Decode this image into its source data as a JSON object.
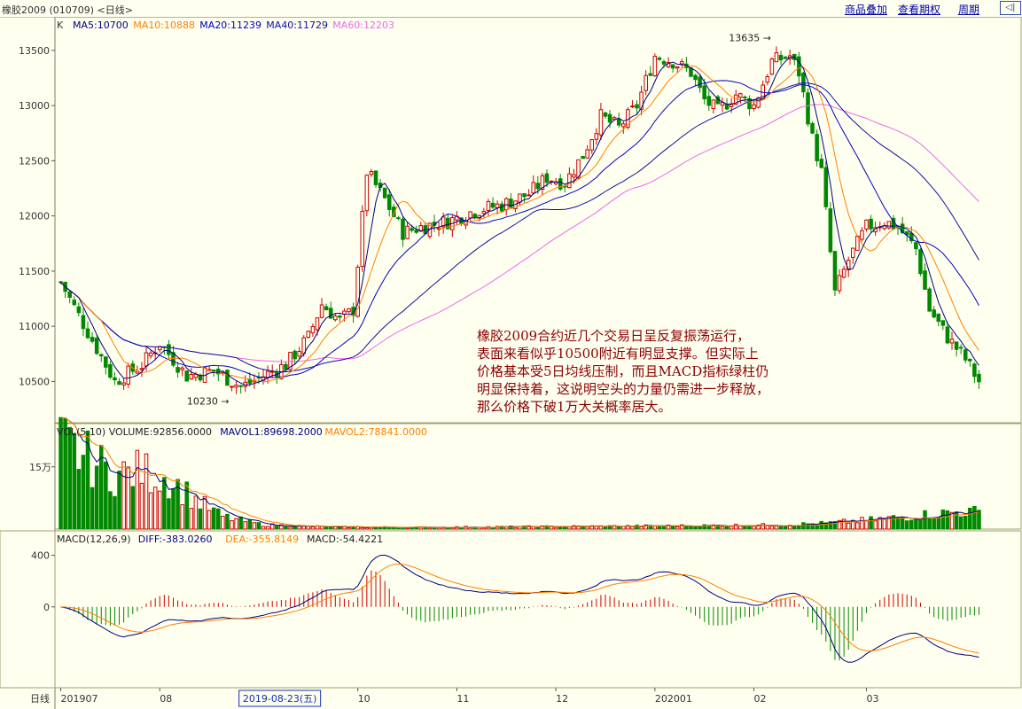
{
  "header": {
    "title": "橡胶2009 (010709) <日线>",
    "links": [
      "商品叠加",
      "查看期权",
      "周期"
    ],
    "nav_icon": "arrow-left-box-icon"
  },
  "colors": {
    "background": "#fffff0",
    "up": "#cc0000",
    "down": "#008800",
    "ma5": "#000080",
    "ma10": "#ff8000",
    "ma20": "#0000c0",
    "ma40": "#1010a0",
    "ma60": "#ee66ee",
    "grid": "#c8c8a0"
  },
  "chart_data": [
    {
      "type": "candlestick",
      "title": "",
      "legend": {
        "prefix": "K",
        "items": [
          {
            "text": "MA5:10700",
            "color": "#000080"
          },
          {
            "text": "MA10:10888",
            "color": "#ff8000"
          },
          {
            "text": "MA20:11239",
            "color": "#0000c0"
          },
          {
            "text": "MA40:11729",
            "color": "#1010a0"
          },
          {
            "text": "MA60:12203",
            "color": "#ee66ee"
          }
        ]
      },
      "yticks": [
        13500,
        13000,
        12500,
        12000,
        11500,
        11000,
        10500
      ],
      "ylim": [
        10150,
        13780
      ],
      "anchors_close": [
        [
          0,
          11400
        ],
        [
          6,
          10950
        ],
        [
          12,
          10500
        ],
        [
          18,
          10650
        ],
        [
          22,
          10850
        ],
        [
          28,
          10550
        ],
        [
          34,
          10600
        ],
        [
          40,
          10450
        ],
        [
          45,
          10550
        ],
        [
          50,
          10650
        ],
        [
          55,
          10900
        ],
        [
          58,
          11200
        ],
        [
          62,
          11050
        ],
        [
          65,
          11150
        ],
        [
          68,
          12400
        ],
        [
          72,
          12150
        ],
        [
          76,
          11850
        ],
        [
          80,
          11900
        ],
        [
          86,
          11950
        ],
        [
          92,
          12050
        ],
        [
          98,
          12100
        ],
        [
          104,
          12200
        ],
        [
          108,
          12350
        ],
        [
          112,
          12300
        ],
        [
          116,
          12550
        ],
        [
          120,
          12900
        ],
        [
          124,
          12800
        ],
        [
          128,
          13000
        ],
        [
          132,
          13450
        ],
        [
          136,
          13400
        ],
        [
          140,
          13300
        ],
        [
          143,
          13050
        ],
        [
          146,
          12950
        ],
        [
          150,
          13100
        ],
        [
          154,
          13000
        ],
        [
          158,
          13400
        ],
        [
          162,
          13450
        ],
        [
          164,
          13300
        ],
        [
          167,
          12700
        ],
        [
          169,
          12400
        ],
        [
          172,
          11300
        ],
        [
          175,
          11600
        ],
        [
          179,
          11900
        ],
        [
          183,
          11950
        ],
        [
          186,
          11900
        ],
        [
          190,
          11700
        ],
        [
          193,
          11150
        ],
        [
          197,
          10900
        ],
        [
          201,
          10700
        ],
        [
          204,
          10500
        ]
      ],
      "annotations": [
        {
          "text": "13635",
          "kind": "high"
        },
        {
          "text": "10230",
          "kind": "low"
        }
      ]
    },
    {
      "type": "bar",
      "title": "",
      "legend": [
        {
          "text": "VOL(5,10) VOLUME:92856.0000",
          "color": "#222222"
        },
        {
          "text": "MAVOL1:89698.2000",
          "color": "#000080"
        },
        {
          "text": "MAVOL2:78841.0000",
          "color": "#ff8000"
        }
      ],
      "yticks_label": "15万",
      "anchors_volume": [
        [
          0,
          210000
        ],
        [
          6,
          170000
        ],
        [
          12,
          130000
        ],
        [
          18,
          140000
        ],
        [
          24,
          120000
        ],
        [
          30,
          70000
        ],
        [
          36,
          30000
        ],
        [
          45,
          10000
        ],
        [
          60,
          5000
        ],
        [
          80,
          4000
        ],
        [
          110,
          6000
        ],
        [
          140,
          8000
        ],
        [
          160,
          10000
        ],
        [
          170,
          14000
        ],
        [
          180,
          22000
        ],
        [
          190,
          32000
        ],
        [
          200,
          42000
        ],
        [
          204,
          40000
        ]
      ]
    },
    {
      "type": "line",
      "title": "",
      "legend": [
        {
          "text": "MACD(12,26,9)",
          "color": "#222222"
        },
        {
          "text": "DIFF:-383.0260",
          "color": "#000080"
        },
        {
          "text": "DEA:-355.8149",
          "color": "#ff8000"
        },
        {
          "text": "MACD:-54.4221",
          "color": "#222222"
        }
      ],
      "yticks": [
        400,
        0
      ],
      "ylim": [
        -600,
        480
      ]
    },
    {
      "type": "axis",
      "xlabel": "日线",
      "x_ticks": [
        "201907",
        "08",
        "10",
        "11",
        "12",
        "202001",
        "02",
        "03"
      ],
      "crosshair_date": "2019-08-23(五)"
    }
  ],
  "annotation": [
    "橡胶2009合约近几个交易日呈反复振荡运行，",
    "表面来看似乎10500附近有明显支撑。但实际上",
    "价格基本受5日均线压制，而且MACD指标绿柱仍",
    "明显保持着，这说明空头的力量仍需进一步释放，",
    "那么价格下破1万大关概率居大。"
  ]
}
